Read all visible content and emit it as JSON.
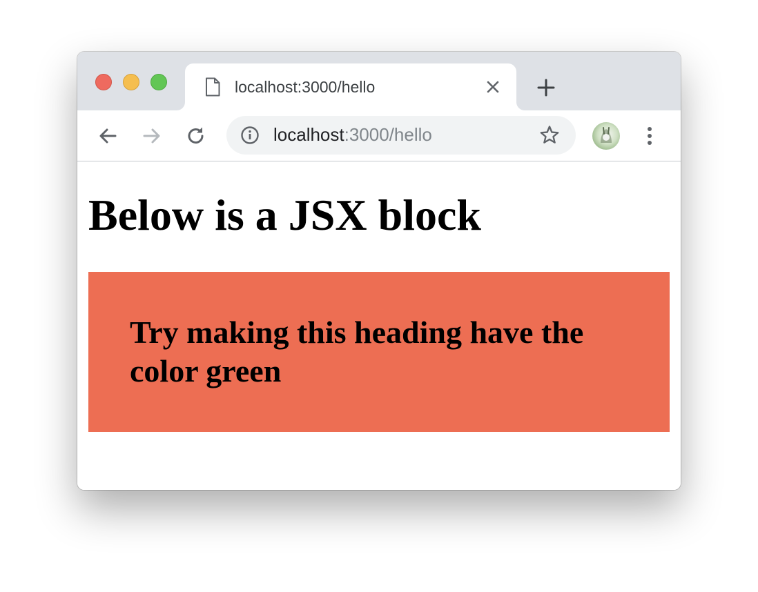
{
  "browser": {
    "tab": {
      "title": "localhost:3000/hello",
      "icon": "document-icon"
    },
    "address_bar": {
      "host": "localhost",
      "path": ":3000/hello"
    },
    "icons": {
      "back": "arrow-left-icon",
      "forward": "arrow-right-icon",
      "reload": "reload-icon",
      "info": "info-icon",
      "bookmark": "star-icon",
      "menu": "kebab-menu-icon",
      "new_tab": "plus-icon",
      "close_tab": "close-icon"
    }
  },
  "page": {
    "heading": "Below is a JSX block",
    "jsx_heading": "Try making this heading have the color green",
    "jsx_block_color": "#ed6e53"
  }
}
